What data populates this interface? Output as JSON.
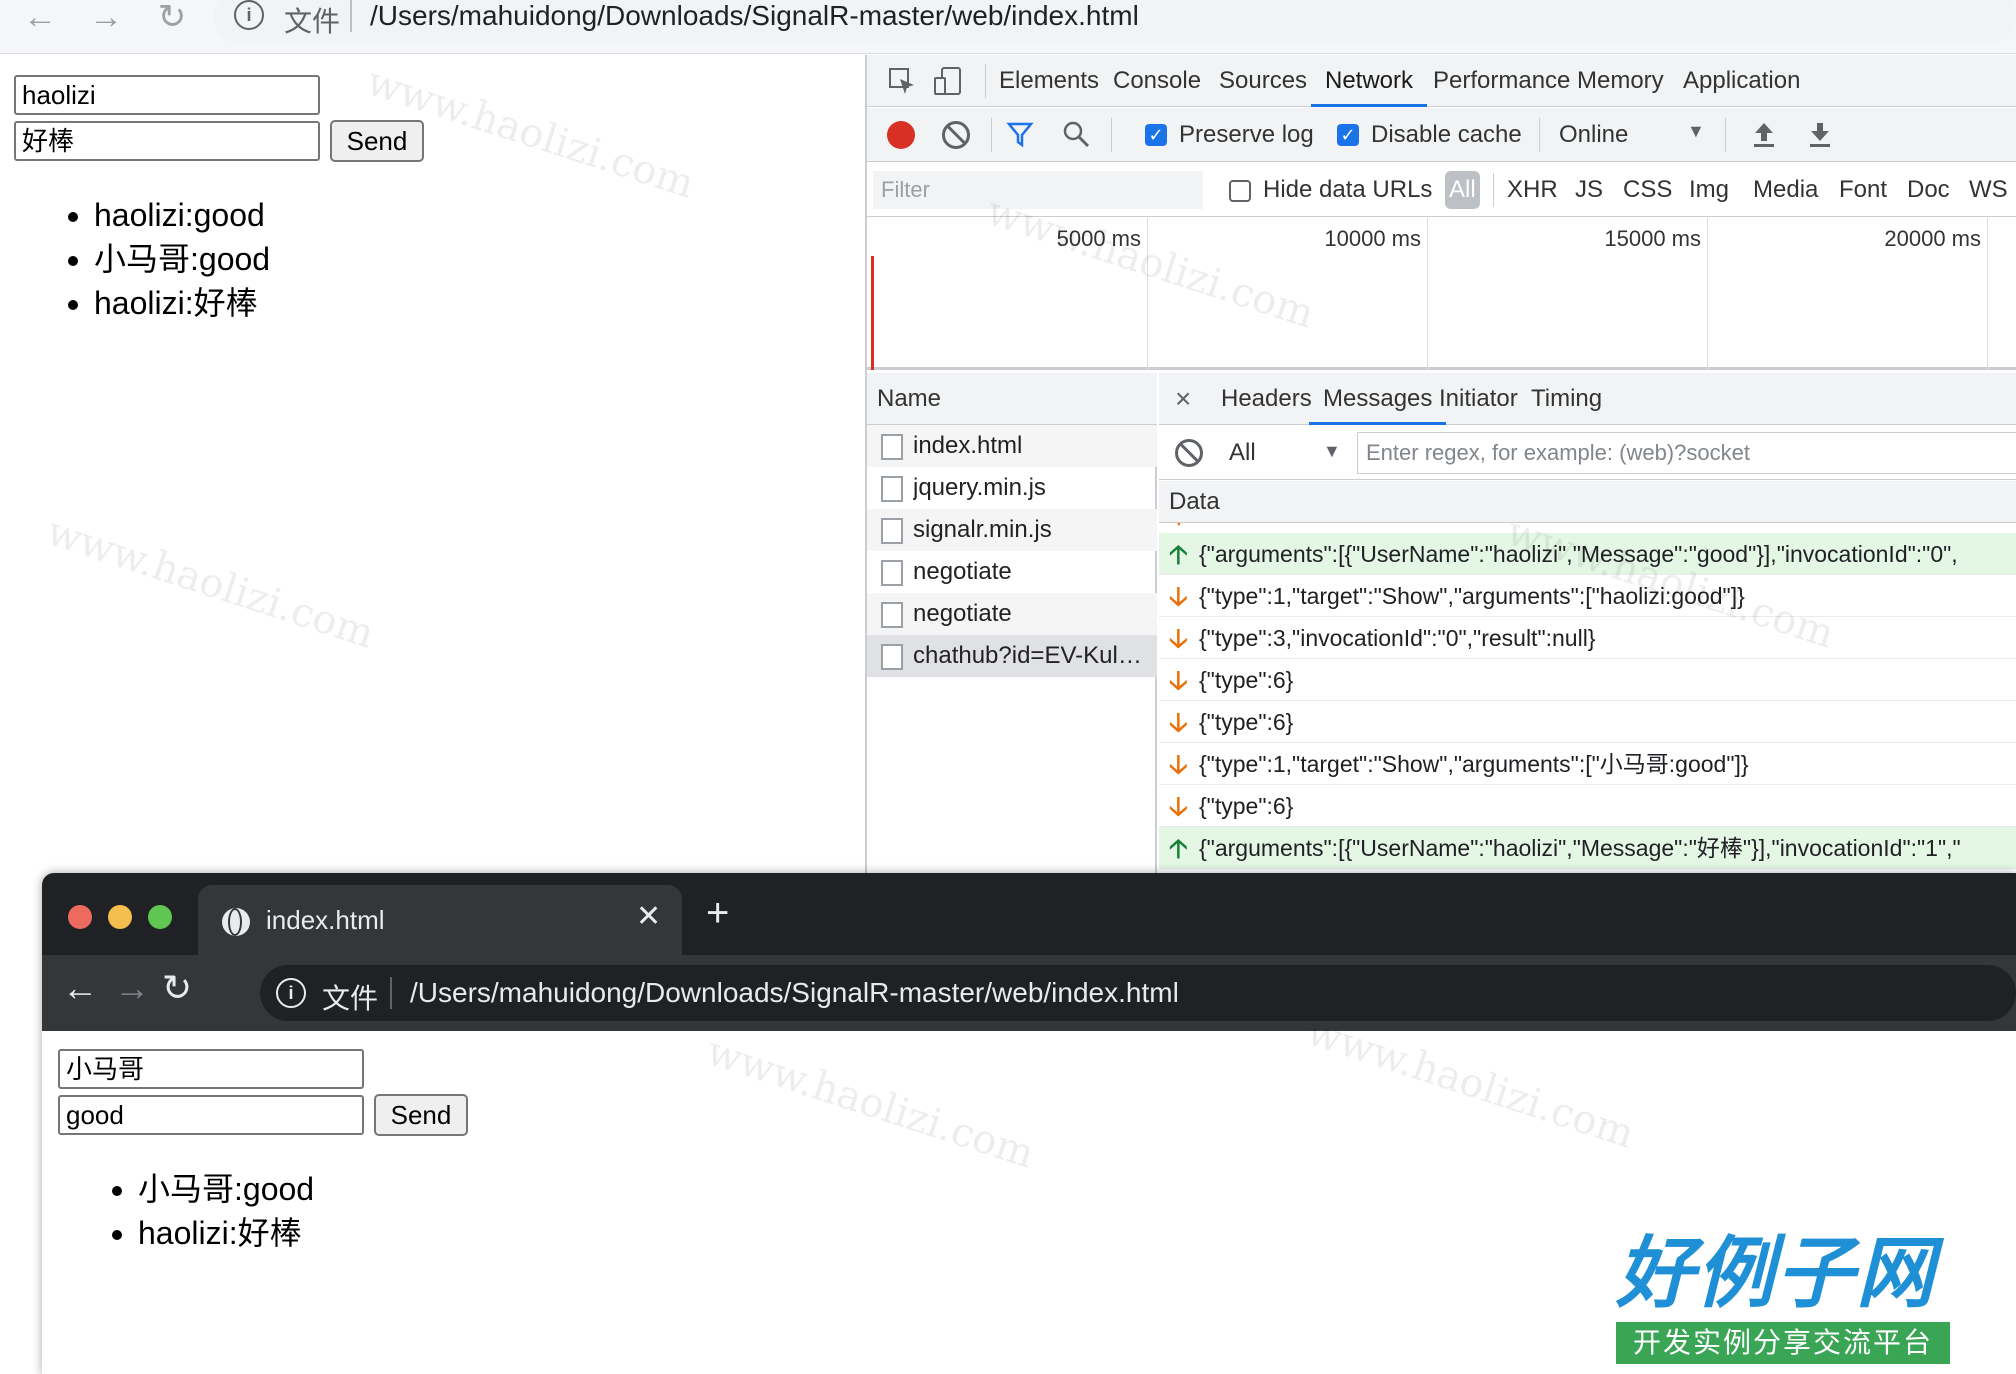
{
  "top_browser": {
    "address": {
      "file_label": "文件",
      "url": "/Users/mahuidong/Downloads/SignalR-master/web/index.html"
    },
    "page": {
      "username_value": "haolizi",
      "message_value": "好棒",
      "send_label": "Send",
      "messages": [
        "haolizi:good",
        "小马哥:good",
        "haolizi:好棒"
      ]
    }
  },
  "devtools": {
    "tabs": [
      "Elements",
      "Console",
      "Sources",
      "Network",
      "Performance",
      "Memory",
      "Application"
    ],
    "active_tab": "Network",
    "toolbar": {
      "preserve_log": "Preserve log",
      "disable_cache": "Disable cache",
      "throttle": "Online"
    },
    "filterbar": {
      "placeholder": "Filter",
      "hide_data_urls": "Hide data URLs",
      "types": [
        "All",
        "XHR",
        "JS",
        "CSS",
        "Img",
        "Media",
        "Font",
        "Doc",
        "WS"
      ]
    },
    "timeline": [
      "5000 ms",
      "10000 ms",
      "15000 ms",
      "20000 ms"
    ],
    "name_panel": {
      "header": "Name",
      "rows": [
        "index.html",
        "jquery.min.js",
        "signalr.min.js",
        "negotiate",
        "negotiate",
        "chathub?id=EV-Kul…"
      ]
    },
    "detail": {
      "tabs": [
        "Headers",
        "Messages",
        "Initiator",
        "Timing"
      ],
      "active_tab": "Messages",
      "filter_all": "All",
      "regex_placeholder": "Enter regex, for example: (web)?socket",
      "data_header": "Data",
      "messages": [
        {
          "dir": "up",
          "text": "{\"arguments\":[{\"UserName\":\"haolizi\",\"Message\":\"good\"}],\"invocationId\":\"0\","
        },
        {
          "dir": "down",
          "text": "{\"type\":1,\"target\":\"Show\",\"arguments\":[\"haolizi:good\"]}"
        },
        {
          "dir": "down",
          "text": "{\"type\":3,\"invocationId\":\"0\",\"result\":null}"
        },
        {
          "dir": "down",
          "text": "{\"type\":6}"
        },
        {
          "dir": "down",
          "text": "{\"type\":6}"
        },
        {
          "dir": "down",
          "text": "{\"type\":1,\"target\":\"Show\",\"arguments\":[\"小马哥:good\"]}"
        },
        {
          "dir": "down",
          "text": "{\"type\":6}"
        },
        {
          "dir": "up",
          "text": "{\"arguments\":[{\"UserName\":\"haolizi\",\"Message\":\"好棒\"}],\"invocationId\":\"1\",\""
        }
      ]
    }
  },
  "second_browser": {
    "tab_title": "index.html",
    "address": {
      "file_label": "文件",
      "url": "/Users/mahuidong/Downloads/SignalR-master/web/index.html"
    },
    "page": {
      "username_value": "小马哥",
      "message_value": "good",
      "send_label": "Send",
      "messages": [
        "小马哥:good",
        "haolizi:好棒"
      ]
    }
  },
  "logo": {
    "main": "好例子网",
    "sub": "开发实例分享交流平台"
  },
  "watermark": "www.haolizi.com",
  "colors": {
    "accent": "#1a73e8",
    "record": "#d93025",
    "sent_row": "#e4f7e4",
    "arrow_up": "#188038",
    "arrow_down": "#e8710a"
  }
}
